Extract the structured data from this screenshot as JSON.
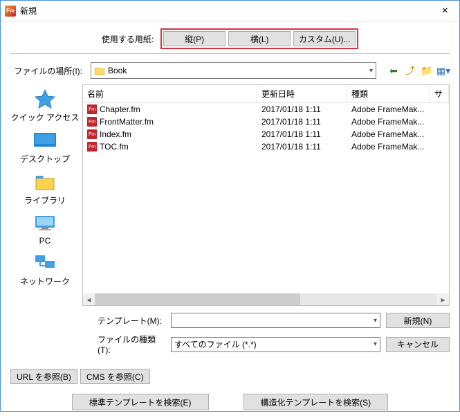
{
  "title": "新規",
  "paper": {
    "label": "使用する用紙:",
    "portrait": "縦(P)",
    "landscape": "横(L)",
    "custom": "カスタム(U)..."
  },
  "location": {
    "label": "ファイルの場所(I):",
    "value": "Book"
  },
  "columns": {
    "name": "名前",
    "date": "更新日時",
    "type": "種類",
    "size": "サ"
  },
  "places": {
    "quick": "クイック アクセス",
    "desktop": "デスクトップ",
    "library": "ライブラリ",
    "pc": "PC",
    "network": "ネットワーク"
  },
  "files": [
    {
      "name": "Chapter.fm",
      "date": "2017/01/18 1:11",
      "type": "Adobe FrameMak..."
    },
    {
      "name": "FrontMatter.fm",
      "date": "2017/01/18 1:11",
      "type": "Adobe FrameMak..."
    },
    {
      "name": "Index.fm",
      "date": "2017/01/18 1:11",
      "type": "Adobe FrameMak..."
    },
    {
      "name": "TOC.fm",
      "date": "2017/01/18 1:11",
      "type": "Adobe FrameMak..."
    }
  ],
  "template": {
    "label": "テンプレート(M):",
    "value": "",
    "new_btn": "新規(N)"
  },
  "filetype": {
    "label": "ファイルの種類(T):",
    "value": "すべてのファイル (*.*)",
    "cancel_btn": "キャンセル"
  },
  "refs": {
    "url": "URL を参照(B)",
    "cms": "CMS を参照(C)"
  },
  "search": {
    "std": "標準テンプレートを検索(E)",
    "struct": "構造化テンプレートを検索(S)"
  }
}
